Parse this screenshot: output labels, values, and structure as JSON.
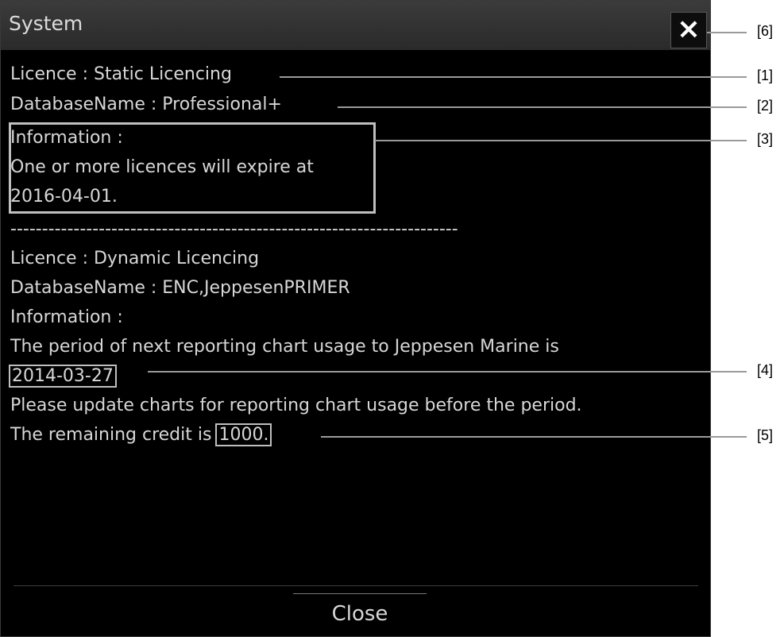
{
  "window": {
    "title": "System",
    "close_icon": "×"
  },
  "section1": {
    "licence": "Licence : Static Licencing",
    "database": "DatabaseName : Professional+",
    "info_label": "Information :",
    "info_line1": "One or more licences will expire at",
    "info_line2": "2016-04-01."
  },
  "separator": "-----------------------------------------------------------------------",
  "section2": {
    "licence": "Licence : Dynamic Licencing",
    "database": "DatabaseName : ENC,JeppesenPRIMER",
    "info_label": "Information :",
    "period_text": "The period of next reporting chart usage to Jeppesen Marine is",
    "period_date": "2014-03-27",
    "update_text": "Please update charts for reporting chart usage before the period.",
    "credit_prefix": "The remaining credit is ",
    "credit_value": "1000."
  },
  "footer": {
    "close_label": "Close"
  },
  "callouts": [
    "[1]",
    "[2]",
    "[3]",
    "[4]",
    "[5]",
    "[6]"
  ]
}
